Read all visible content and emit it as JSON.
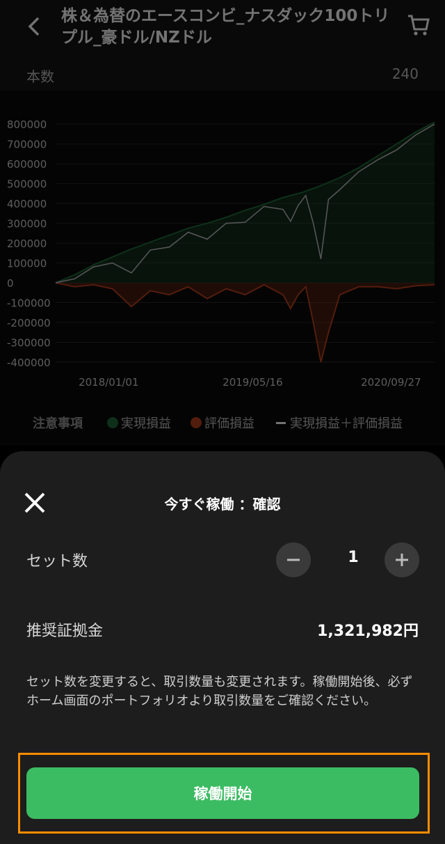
{
  "header": {
    "title": "株＆為替のエースコンビ_ナスダック100トリプル_豪ドル/NZドル",
    "count_label": "本数",
    "count_value": "240"
  },
  "legend": {
    "notice": "注意事項",
    "realized": "実現損益",
    "unrealized": "評価損益",
    "total": "実現損益＋評価損益"
  },
  "colors": {
    "realized": "#1f6b3a",
    "unrealized": "#b8401e",
    "total": "#bdbdbd",
    "accent": "#3cbc62",
    "highlight": "#ff8c00"
  },
  "chart_data": {
    "type": "line",
    "x_ticks": [
      "2018/01/01",
      "2019/05/16",
      "2020/09/27"
    ],
    "y_ticks": [
      "800000",
      "700000",
      "600000",
      "500000",
      "400000",
      "300000",
      "200000",
      "100000",
      "0",
      "-100000",
      "-200000",
      "-300000",
      "-400000"
    ],
    "ylim": [
      -400000,
      850000
    ],
    "xlim": [
      0,
      100
    ],
    "grid": true,
    "series": [
      {
        "name": "実現損益",
        "type": "area",
        "x": [
          0,
          5,
          10,
          15,
          20,
          25,
          30,
          35,
          40,
          45,
          50,
          55,
          60,
          65,
          70,
          75,
          80,
          85,
          90,
          95,
          100
        ],
        "y": [
          0,
          40000,
          90000,
          130000,
          170000,
          205000,
          240000,
          275000,
          300000,
          330000,
          365000,
          395000,
          430000,
          455000,
          490000,
          530000,
          580000,
          640000,
          700000,
          760000,
          810000
        ]
      },
      {
        "name": "評価損益",
        "type": "area",
        "x": [
          0,
          5,
          10,
          15,
          20,
          25,
          30,
          35,
          40,
          45,
          50,
          55,
          60,
          62,
          64,
          66,
          68,
          70,
          72,
          75,
          80,
          85,
          90,
          95,
          100
        ],
        "y": [
          0,
          -20000,
          -10000,
          -30000,
          -120000,
          -40000,
          -60000,
          -20000,
          -80000,
          -30000,
          -60000,
          -10000,
          -60000,
          -130000,
          -60000,
          -20000,
          -200000,
          -400000,
          -250000,
          -60000,
          -20000,
          -20000,
          -30000,
          -15000,
          -10000
        ]
      },
      {
        "name": "実現損益＋評価損益",
        "type": "line",
        "x": [
          0,
          5,
          10,
          15,
          20,
          25,
          30,
          35,
          40,
          45,
          50,
          55,
          60,
          62,
          64,
          66,
          68,
          70,
          72,
          75,
          80,
          85,
          90,
          95,
          100
        ],
        "y": [
          0,
          20000,
          80000,
          100000,
          50000,
          165000,
          180000,
          255000,
          220000,
          300000,
          305000,
          385000,
          370000,
          310000,
          390000,
          440000,
          300000,
          120000,
          420000,
          470000,
          560000,
          620000,
          670000,
          745000,
          800000
        ]
      }
    ]
  },
  "modal": {
    "title": "今すぐ稼働 ：確認",
    "set_label": "セット数",
    "set_value": "1",
    "margin_label": "推奨証拠金",
    "margin_value": "1,321,982円",
    "note": "セット数を変更すると、取引数量も変更されます。稼働開始後、必ずホーム画面のポートフォリオより取引数量をご確認ください。",
    "start_label": "稼働開始"
  },
  "icons": {
    "back": "chevron-left-icon",
    "cart": "cart-icon",
    "close": "close-icon",
    "minus": "minus-icon",
    "plus": "plus-icon"
  }
}
